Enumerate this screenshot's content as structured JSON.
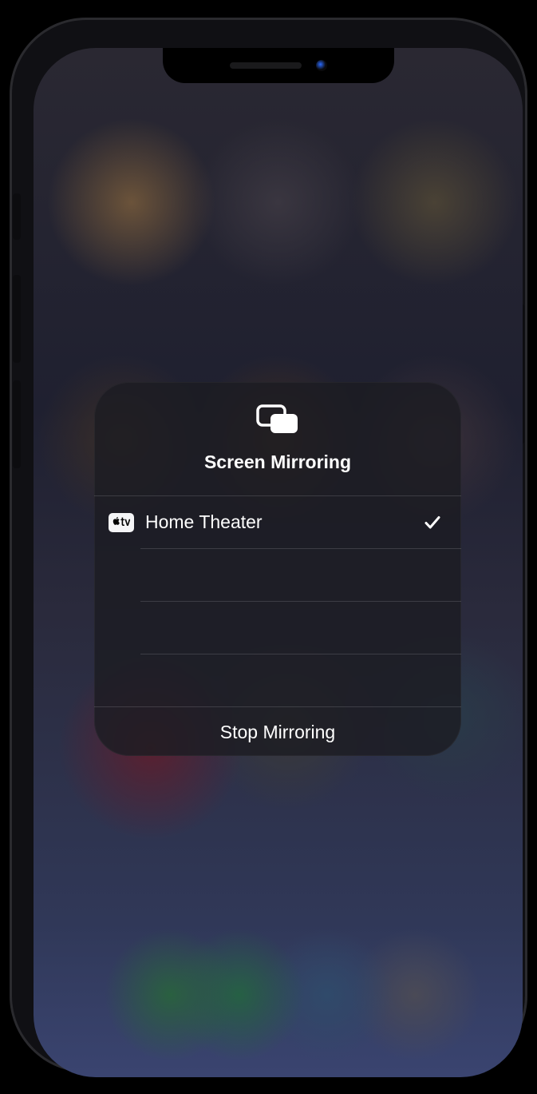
{
  "panel": {
    "title": "Screen Mirroring",
    "footer_label": "Stop Mirroring"
  },
  "devices": [
    {
      "name": "Home Theater",
      "icon": "apple-tv-icon",
      "selected": true
    }
  ]
}
